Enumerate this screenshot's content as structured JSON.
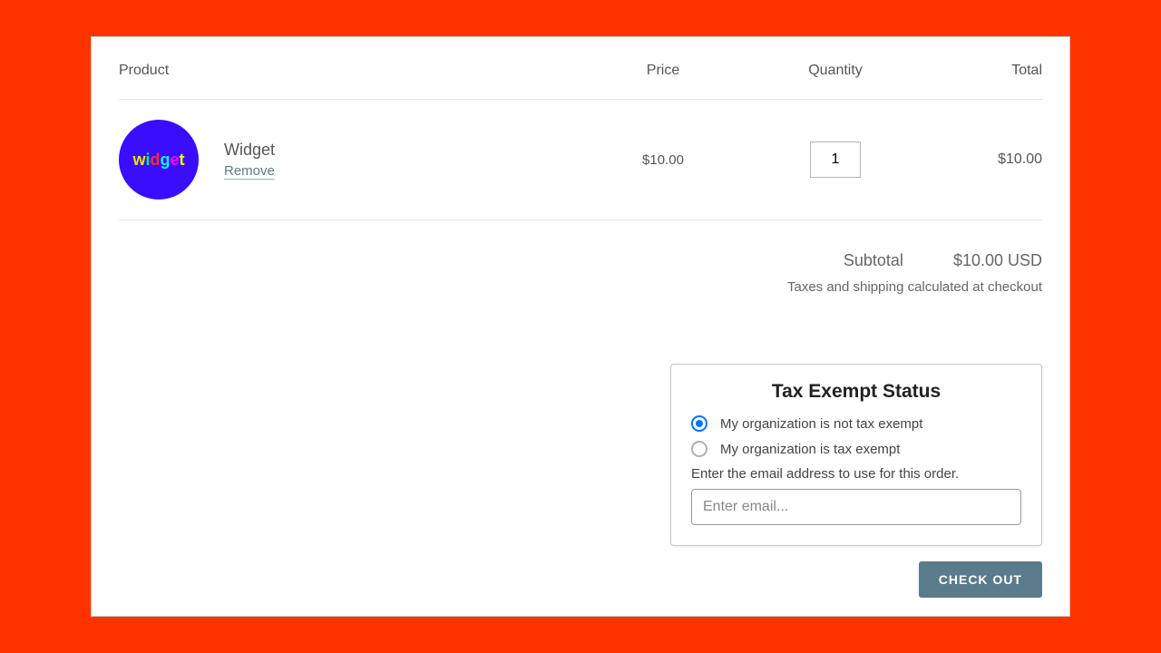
{
  "headers": {
    "product": "Product",
    "price": "Price",
    "quantity": "Quantity",
    "total": "Total"
  },
  "item": {
    "name": "Widget",
    "remove": "Remove",
    "price": "$10.00",
    "qty": "1",
    "total": "$10.00",
    "logo_text": "widget"
  },
  "subtotal": {
    "label": "Subtotal",
    "value": "$10.00 USD"
  },
  "note": "Taxes and shipping calculated at checkout",
  "tax": {
    "title": "Tax Exempt Status",
    "opt_not": "My organization is not tax exempt",
    "opt_yes": "My organization is tax exempt",
    "email_label": "Enter the email address to use for this order.",
    "email_placeholder": "Enter email..."
  },
  "checkout": "CHECK OUT"
}
